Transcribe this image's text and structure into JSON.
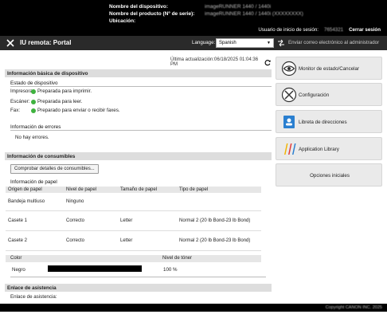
{
  "device": {
    "name_label": "Nombre del dispositivo:",
    "name_value": "imageRUNNER 1440 / 1440i",
    "product_label": "Nombre del producto (Nº de serie):",
    "product_value": "imageRUNNER 1440 / 1440i (XXXXXXXX)",
    "location_label": "Ubicación:",
    "location_value": ""
  },
  "session": {
    "user_label": "Usuario de inicio de sesión:",
    "user_value": "7654321",
    "logout": "Cerrar sesión"
  },
  "nav": {
    "title": "IU remota: Portal",
    "language_label": "Language:",
    "language_value": "Spanish",
    "mail_admin": "Enviar correo electrónico al administrador"
  },
  "update": {
    "text": "Última actualización:06/18/2025 01:04:36 PM"
  },
  "basic": {
    "title": "Información básica de dispositivo",
    "status_title": "Estado de dispositivo",
    "status": [
      {
        "label": "Impresora:",
        "value": "Preparada para imprimir."
      },
      {
        "label": "Escáner:",
        "value": "Preparada para leer."
      },
      {
        "label": "Fax:",
        "value": "Preparado para enviar o recibir faxes."
      }
    ],
    "errors_title": "Información de errores",
    "errors_value": "No hay errores."
  },
  "consumables": {
    "title": "Información de consumibles",
    "check_button": "Comprobar detalles de consumibles...",
    "paper_title": "Información de papel",
    "columns": [
      "Origen de papel",
      "Nivel de papel",
      "Tamaño de papel",
      "Tipo de papel"
    ],
    "rows": [
      {
        "source": "Bandeja multiuso",
        "level": "Ninguno",
        "size": "",
        "type": ""
      },
      {
        "source": "Casete 1",
        "level": "Correcto",
        "size": "Letter",
        "type": "Normal 2 (20 lb Bond-23 lb Bond)"
      },
      {
        "source": "Casete 2",
        "level": "Correcto",
        "size": "Letter",
        "type": "Normal 2 (20 lb Bond-23 lb Bond)"
      }
    ],
    "toner_color_header": "Color",
    "toner_level_header": "Nivel de tóner",
    "toner_color": "Negro",
    "toner_level": "100 %",
    "toner_fraction": 1.0
  },
  "support": {
    "title": "Enlace de asistencia",
    "label": "Enlace de asistencia:"
  },
  "menu": {
    "monitor": "Monitor de estado/Cancelar",
    "settings": "Configuración",
    "address_book": "Libreta de direcciones",
    "app_library": "Application Library",
    "home_options": "Opciones iniciales"
  },
  "footer": {
    "copyright": "Copyright CANON INC. 2025"
  },
  "colors": {
    "status_ok": "#3fb23f",
    "top_band": "#000000",
    "nav_band": "#2a2a2a"
  }
}
